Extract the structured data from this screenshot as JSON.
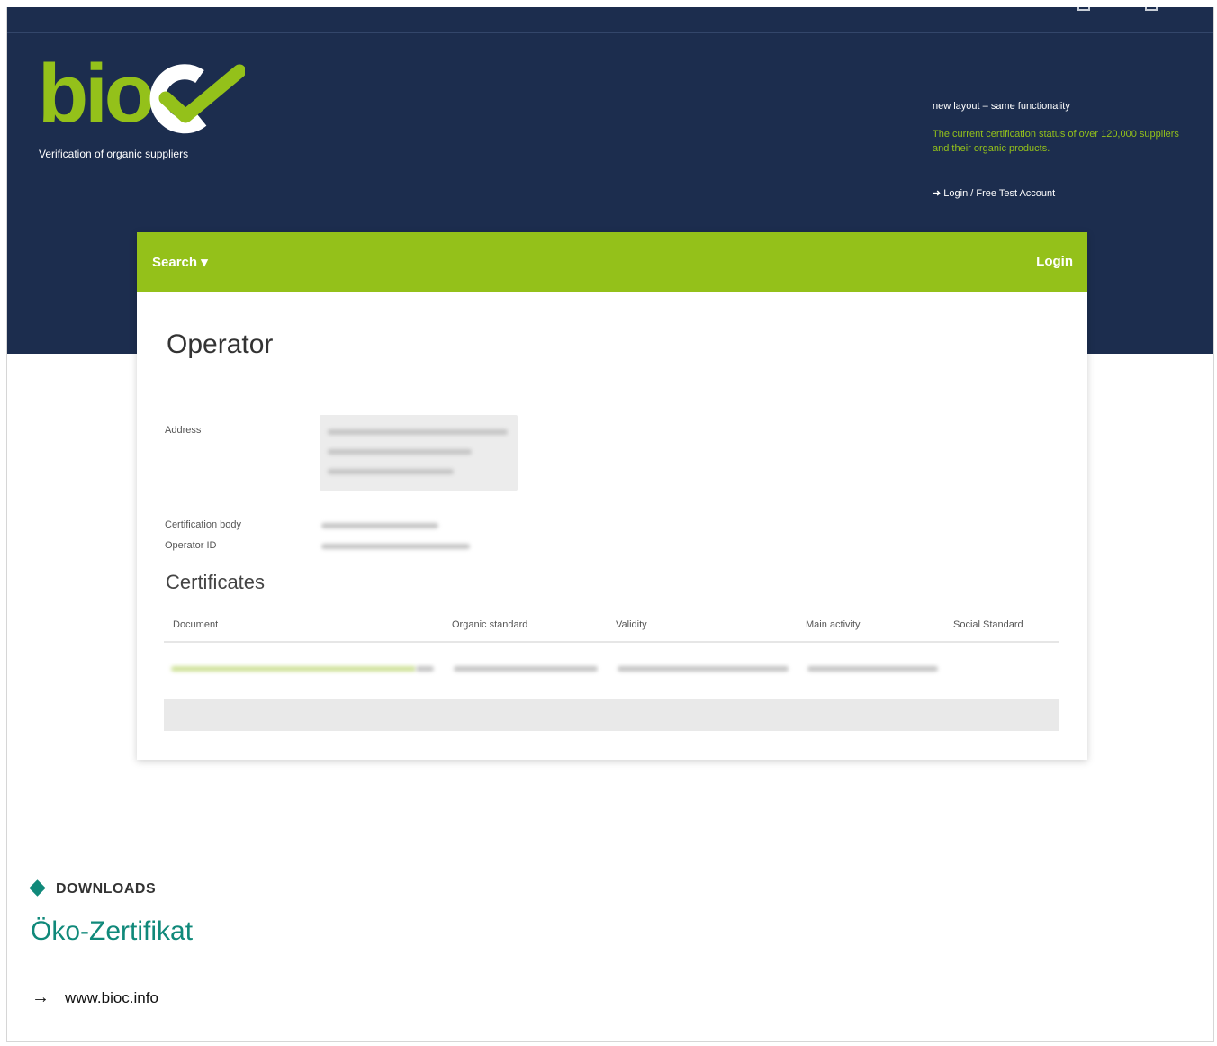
{
  "header": {
    "logo_text": "bio",
    "tagline": "Verification of organic suppliers",
    "layout_note": "new layout – same functionality",
    "description": "The current certification status of over 120,000 suppliers and their organic products.",
    "login_link": "Login / Free Test Account",
    "login_icon": "arrow-right-to-bracket-icon"
  },
  "nav": {
    "search_label": "Search ▾",
    "login_label": "Login"
  },
  "operator": {
    "title": "Operator",
    "address_label": "Address",
    "certification_body_label": "Certification body",
    "operator_id_label": "Operator ID"
  },
  "certificates": {
    "title": "Certificates",
    "columns": [
      "Document",
      "Organic standard",
      "Validity",
      "Main activity",
      "Social Standard"
    ]
  },
  "downloads": {
    "label": "DOWNLOADS",
    "title": "Öko-Zertifikat",
    "link_text": "www.bioc.info"
  },
  "colors": {
    "navy": "#1c2d4e",
    "green": "#94c11a",
    "teal": "#10897a"
  }
}
